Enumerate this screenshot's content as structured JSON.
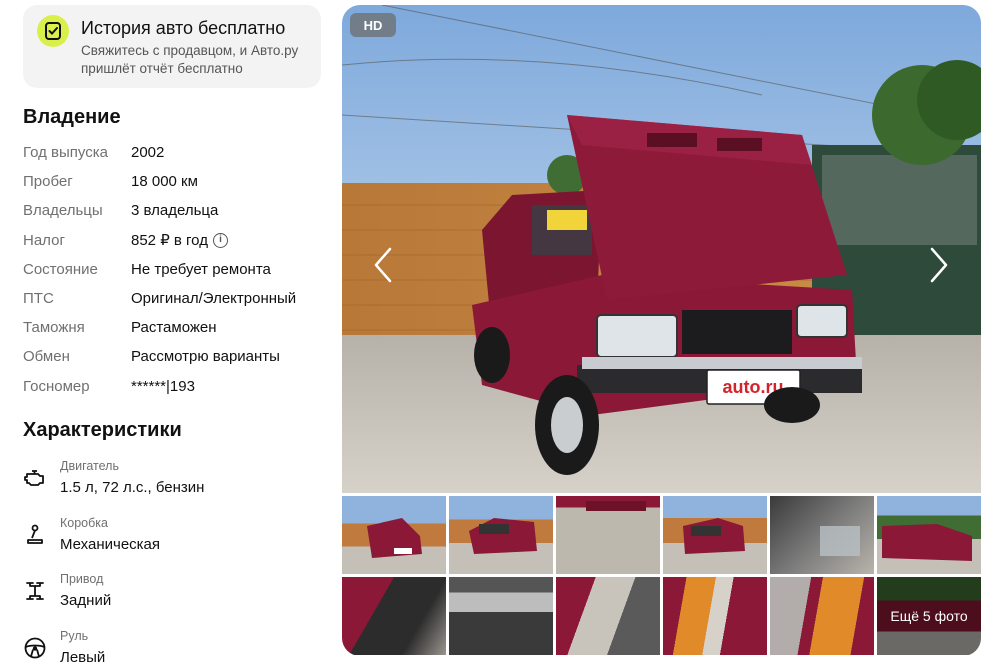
{
  "banner": {
    "title": "История авто бесплатно",
    "subtitle": "Свяжитесь с продавцом, и Авто.ру пришлёт отчёт бесплатно",
    "icon": "report-check-icon",
    "accent": "#d9f04a"
  },
  "ownership": {
    "heading": "Владение",
    "rows": [
      {
        "label": "Год выпуска",
        "value": "2002"
      },
      {
        "label": "Пробег",
        "value": "18 000 км"
      },
      {
        "label": "Владельцы",
        "value": "3 владельца"
      },
      {
        "label": "Налог",
        "value": "852 ₽ в год"
      },
      {
        "label": "Состояние",
        "value": "Не требует ремонта"
      },
      {
        "label": "ПТС",
        "value": "Оригинал/Электронный"
      },
      {
        "label": "Таможня",
        "value": "Растаможен"
      },
      {
        "label": "Обмен",
        "value": "Рассмотрю варианты"
      },
      {
        "label": "Госномер",
        "value": "******|193"
      }
    ],
    "info_icon": "i"
  },
  "specs": {
    "heading": "Характеристики",
    "items": [
      {
        "label": "Двигатель",
        "value": "1.5 л, 72 л.с., бензин",
        "icon": "engine-icon"
      },
      {
        "label": "Коробка",
        "value": "Механическая",
        "icon": "gearbox-icon"
      },
      {
        "label": "Привод",
        "value": "Задний",
        "icon": "drivetrain-icon"
      },
      {
        "label": "Руль",
        "value": "Левый",
        "icon": "steering-wheel-icon"
      }
    ]
  },
  "gallery": {
    "badge": "HD",
    "plate_text": "auto.ru",
    "more_photos": "Ещё 5 фото",
    "car_color": "#8a1836"
  }
}
